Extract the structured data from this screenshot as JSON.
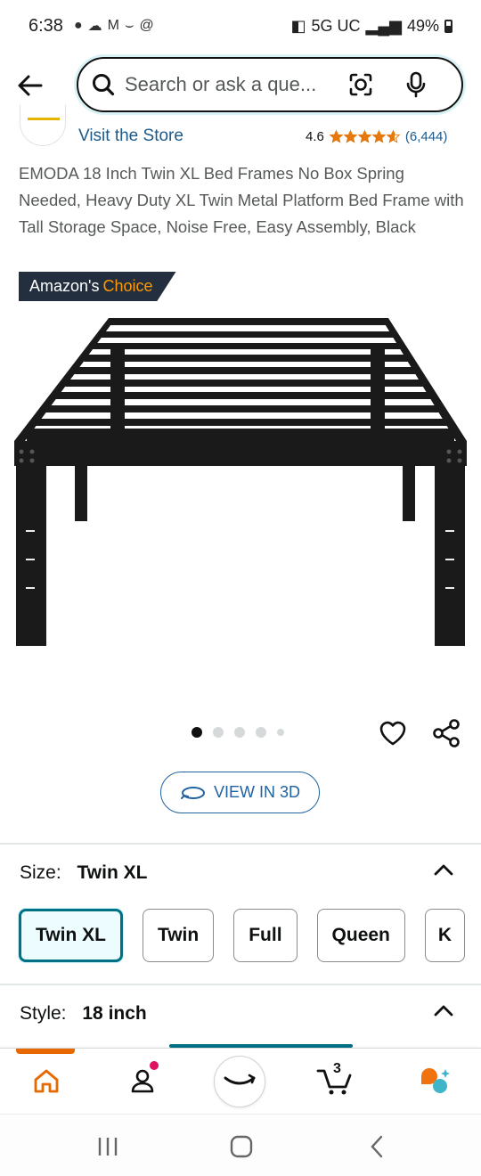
{
  "status_bar": {
    "time": "6:38",
    "network": "5G UC",
    "battery": "49%"
  },
  "search": {
    "placeholder": "Search or ask a que..."
  },
  "store": {
    "visit_label": "Visit the Store",
    "rating": "4.6",
    "rating_count": "(6,444)",
    "stars_value": 4.6
  },
  "product": {
    "title": "EMODA 18 Inch Twin XL Bed Frames No Box Spring Needed, Heavy Duty XL Twin Metal Platform Bed Frame with Tall Storage Space, Noise Free, Easy Assembly, Black",
    "badge_prefix": "Amazon's",
    "badge_choice": "Choice",
    "image_count": 5,
    "active_image": 1
  },
  "view3d": {
    "label": "VIEW IN 3D"
  },
  "size": {
    "label": "Size:",
    "value": "Twin XL",
    "options": [
      "Twin XL",
      "Twin",
      "Full",
      "Queen",
      "K"
    ]
  },
  "style": {
    "label": "Style:",
    "value": "18 inch"
  },
  "bottom_nav": {
    "cart_count": "3",
    "items": [
      "home-icon",
      "account-icon",
      "alexa-icon",
      "cart-icon",
      "rufus-icon"
    ]
  },
  "colors": {
    "accent": "#007185",
    "link": "#1e5a8a",
    "star": "#e47911",
    "badge_bg": "#232f3e",
    "choice": "#ff9900",
    "home_active": "#e86800"
  }
}
